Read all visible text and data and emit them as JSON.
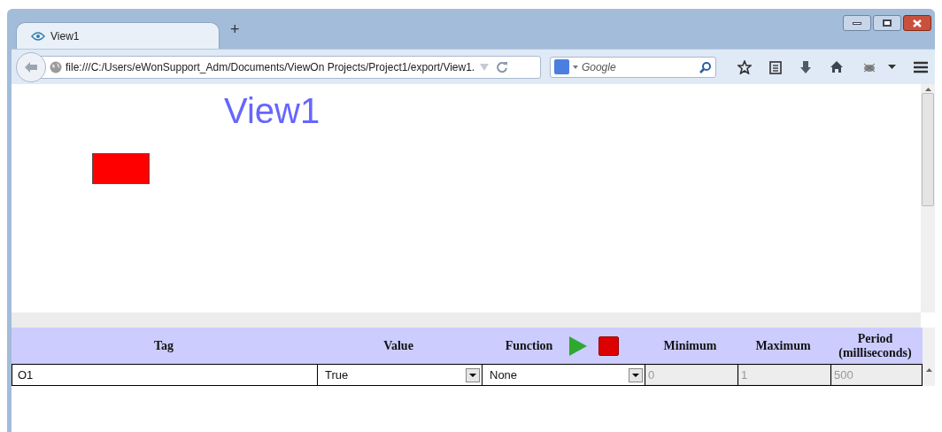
{
  "tabs": [
    {
      "label": "View1",
      "selected": true
    }
  ],
  "new_tab": "+",
  "address_bar": {
    "url": "file:///C:/Users/eWonSupport_Adm/Documents/ViewOn Projects/Project1/export/View1."
  },
  "search": {
    "placeholder": "Google"
  },
  "page": {
    "title": "View1",
    "indicator_on": false
  },
  "table": {
    "columns": [
      "Tag",
      "Value",
      "Function",
      "Minimum",
      "Maximum",
      "Period (milliseconds)"
    ],
    "rows": [
      {
        "tag": "O1",
        "value": "True",
        "function": "None",
        "minimum": "0",
        "maximum": "1",
        "period": "500",
        "disabled": true
      }
    ]
  }
}
